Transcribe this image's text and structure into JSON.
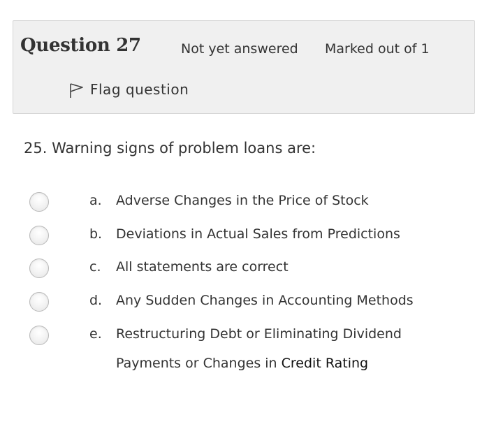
{
  "question": {
    "label": "Question",
    "number": "27",
    "state": "Not yet answered",
    "grade": "Marked out of 1",
    "flag_label": "Flag question",
    "text": "25. Warning signs of problem loans are:"
  },
  "answers": [
    {
      "letter": "a.",
      "text": "Adverse Changes in the Price of Stock"
    },
    {
      "letter": "b.",
      "text": "Deviations in Actual Sales from Predictions"
    },
    {
      "letter": "c.",
      "text": "All statements are correct"
    },
    {
      "letter": "d.",
      "text": "Any Sudden Changes in Accounting Methods"
    },
    {
      "letter": "e.",
      "text": "Restructuring Debt or Eliminating Dividend Payments or Changes in ",
      "text_emphasis": "Credit Rating"
    }
  ],
  "colors": {
    "info_background": "#f0f0f0",
    "info_border": "#d6d6d6",
    "text": "#333333",
    "radio_border": "#b9b9b9"
  }
}
